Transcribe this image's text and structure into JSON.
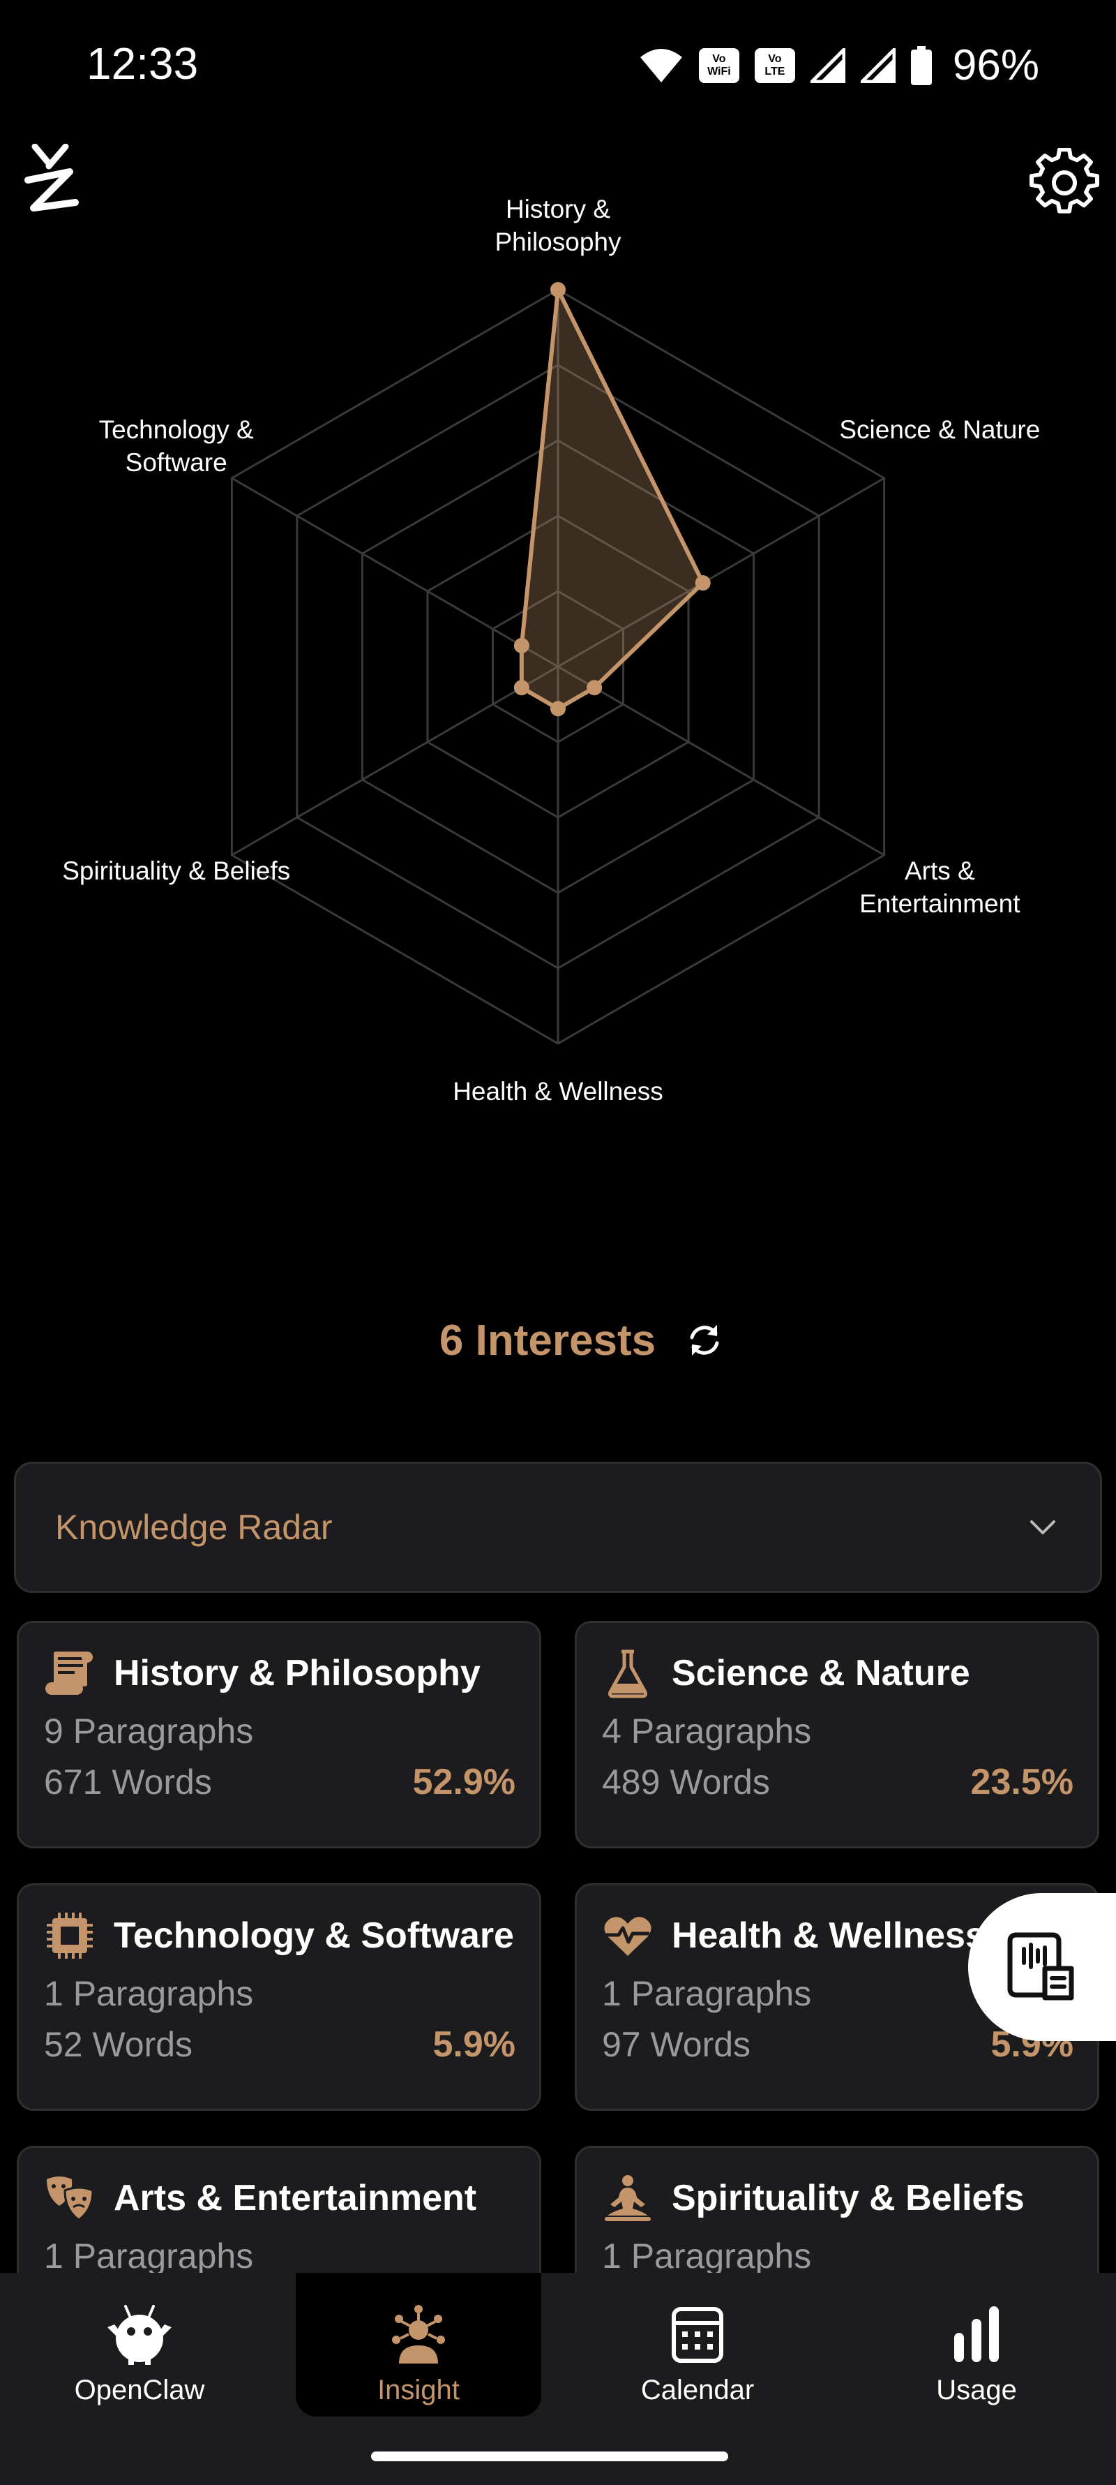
{
  "status_bar": {
    "time": "12:33",
    "battery_percent": "96%",
    "icons": [
      "wifi-icon",
      "vowifi-icon",
      "volte-icon",
      "signal-icon",
      "signal-icon",
      "battery-icon"
    ],
    "chip_vowifi_top": "Vo",
    "chip_vowifi_bottom": "WiFi",
    "chip_volte_top": "Vo",
    "chip_volte_bottom": "LTE"
  },
  "header": {
    "logo_icon": "app-logo-icon",
    "settings_icon": "gear-icon"
  },
  "chart_data": {
    "type": "radar",
    "axes": [
      "History & Philosophy",
      "Science & Nature",
      "Arts & Entertainment",
      "Health & Wellness",
      "Spirituality & Beliefs",
      "Technology & Software"
    ],
    "values": [
      52.9,
      23.5,
      5.9,
      5.9,
      5.9,
      5.9
    ],
    "rlim": [
      0,
      52.9
    ],
    "grid_levels": 5,
    "colors": {
      "fill": "#c4956a",
      "stroke": "#c4956a",
      "grid": "#3a3a3a"
    }
  },
  "interests": {
    "label": "6 Interests",
    "refresh_icon": "refresh-icon"
  },
  "dropdown": {
    "label": "Knowledge Radar",
    "icon": "chevron-down-icon"
  },
  "cards": [
    {
      "title": "History & Philosophy",
      "paragraphs": "9 Paragraphs",
      "words": "671 Words",
      "percent": "52.9%",
      "icon": "scroll-icon"
    },
    {
      "title": "Science & Nature",
      "paragraphs": "4 Paragraphs",
      "words": "489 Words",
      "percent": "23.5%",
      "icon": "flask-icon"
    },
    {
      "title": "Technology & Software",
      "paragraphs": "1 Paragraphs",
      "words": "52 Words",
      "percent": "5.9%",
      "icon": "chip-icon"
    },
    {
      "title": "Health & Wellness",
      "paragraphs": "1 Paragraphs",
      "words": "97 Words",
      "percent": "5.9%",
      "icon": "heartbeat-icon"
    },
    {
      "title": "Arts & Entertainment",
      "paragraphs": "1 Paragraphs",
      "words": "",
      "percent": "",
      "icon": "theater-masks-icon"
    },
    {
      "title": "Spirituality & Beliefs",
      "paragraphs": "1 Paragraphs",
      "words": "",
      "percent": "",
      "icon": "meditation-icon"
    }
  ],
  "fab": {
    "icon": "voice-note-icon"
  },
  "bottom_nav": [
    {
      "label": "OpenClaw",
      "icon": "robot-icon"
    },
    {
      "label": "Insight",
      "icon": "insight-icon"
    },
    {
      "label": "Calendar",
      "icon": "calendar-icon"
    },
    {
      "label": "Usage",
      "icon": "bar-chart-icon"
    }
  ],
  "colors": {
    "accent": "#c4956a",
    "background": "#000000",
    "card": "#1c1c1e",
    "muted_text": "#9a9a9c"
  }
}
